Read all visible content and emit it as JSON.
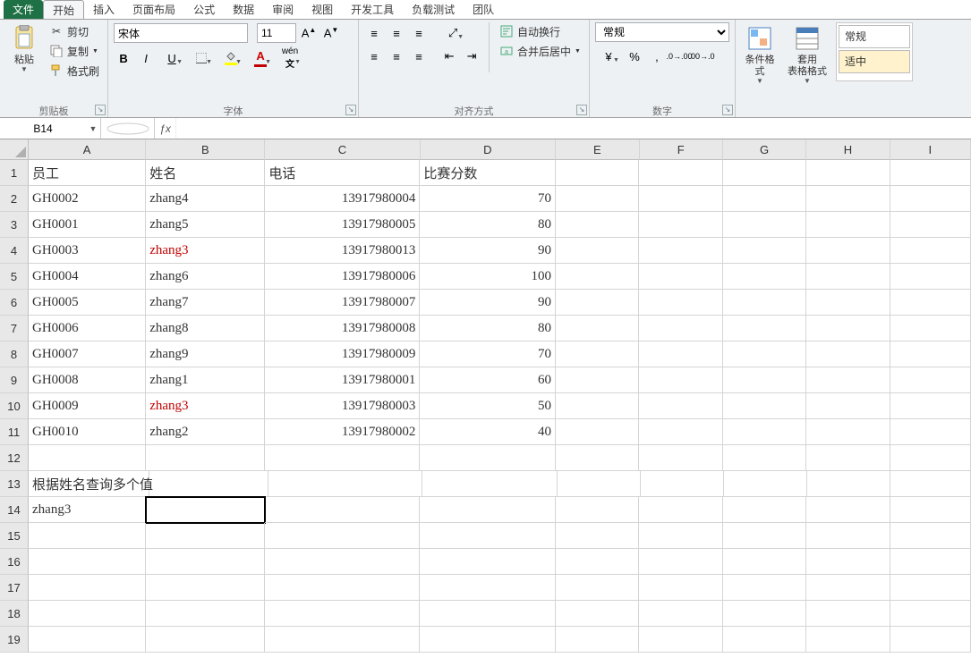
{
  "tabs": {
    "file": "文件",
    "home": "开始",
    "insert": "插入",
    "layout": "页面布局",
    "formula": "公式",
    "data": "数据",
    "review": "审阅",
    "view": "视图",
    "dev": "开发工具",
    "load": "负载测试",
    "team": "团队"
  },
  "clipboard": {
    "paste": "粘贴",
    "cut": "剪切",
    "copy": "复制",
    "fmtpainter": "格式刷",
    "group": "剪贴板"
  },
  "font": {
    "name": "宋体",
    "size": "11",
    "group": "字体"
  },
  "align": {
    "wrap": "自动换行",
    "merge": "合并后居中",
    "group": "对齐方式"
  },
  "number": {
    "format": "常规",
    "group": "数字"
  },
  "styles": {
    "cond": "条件格式",
    "table": "套用\n表格格式",
    "normal": "常规",
    "good": "适中"
  },
  "active_cell": "B14",
  "formula": "",
  "cols": [
    "A",
    "B",
    "C",
    "D",
    "E",
    "F",
    "G",
    "H",
    "I"
  ],
  "rowcount": 19,
  "headers": {
    "A": "员工",
    "B": "姓名",
    "C": "电话",
    "D": "比赛分数"
  },
  "rows": [
    {
      "A": "GH0002",
      "B": "zhang4",
      "C": "13917980004",
      "D": "70"
    },
    {
      "A": "GH0001",
      "B": "zhang5",
      "C": "13917980005",
      "D": "80"
    },
    {
      "A": "GH0003",
      "B": "zhang3",
      "C": "13917980013",
      "D": "90",
      "Bred": true
    },
    {
      "A": "GH0004",
      "B": "zhang6",
      "C": "13917980006",
      "D": "100"
    },
    {
      "A": "GH0005",
      "B": "zhang7",
      "C": "13917980007",
      "D": "90"
    },
    {
      "A": "GH0006",
      "B": "zhang8",
      "C": "13917980008",
      "D": "80"
    },
    {
      "A": "GH0007",
      "B": "zhang9",
      "C": "13917980009",
      "D": "70"
    },
    {
      "A": "GH0008",
      "B": "zhang1",
      "C": "13917980001",
      "D": "60"
    },
    {
      "A": "GH0009",
      "B": "zhang3",
      "C": "13917980003",
      "D": "50",
      "Bred": true
    },
    {
      "A": "GH0010",
      "B": "zhang2",
      "C": "13917980002",
      "D": "40"
    }
  ],
  "extra": {
    "r13A": "根据姓名查询多个值",
    "r14A": "zhang3"
  },
  "colwidths": {
    "A": 135,
    "B": 137,
    "C": 178,
    "D": 156,
    "E": 96,
    "F": 96,
    "G": 96,
    "H": 96,
    "I": 93
  }
}
